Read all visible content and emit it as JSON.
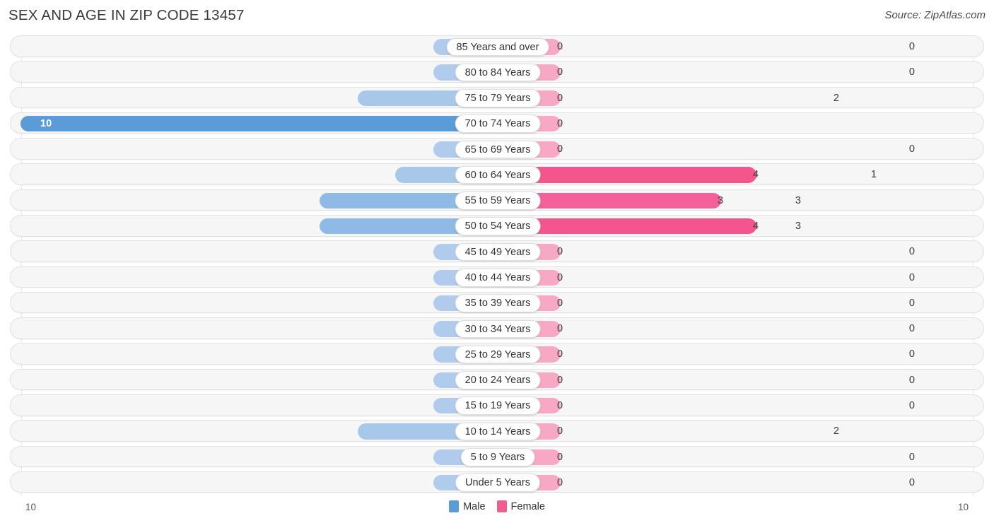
{
  "header": {
    "title": "SEX AND AGE IN ZIP CODE 13457",
    "source": "Source: ZipAtlas.com"
  },
  "legend": {
    "male_label": "Male",
    "female_label": "Female",
    "male_color": "#5b9bd8",
    "female_color": "#ef5e8f"
  },
  "axis": {
    "left_label": "10",
    "right_label": "10"
  },
  "colors": {
    "male_max": "#5b9bd8",
    "male_high": "#7fb0e0",
    "male_mid": "#8fbae6",
    "male_low": "#a8c8ea",
    "male_zero": "#b0cbec",
    "female_max": "#f4558c",
    "female_high": "#f4609a",
    "female_low": "#f78fb5",
    "female_zero": "#f7a8c4",
    "track": "#f6f6f6",
    "track_border": "#e2e2e2",
    "pill_bg": "#ffffff",
    "gridline": "#e8e8e8"
  },
  "chart_data": {
    "type": "bar",
    "subtype": "population-pyramid",
    "title": "SEX AND AGE IN ZIP CODE 13457",
    "xlabel": "",
    "ylabel": "",
    "xlim": [
      10,
      10
    ],
    "axis_max": 10,
    "grid": true,
    "legend_position": "bottom-center",
    "categories": [
      "85 Years and over",
      "80 to 84 Years",
      "75 to 79 Years",
      "70 to 74 Years",
      "65 to 69 Years",
      "60 to 64 Years",
      "55 to 59 Years",
      "50 to 54 Years",
      "45 to 49 Years",
      "40 to 44 Years",
      "35 to 39 Years",
      "30 to 34 Years",
      "25 to 29 Years",
      "20 to 24 Years",
      "15 to 19 Years",
      "10 to 14 Years",
      "5 to 9 Years",
      "Under 5 Years"
    ],
    "series": [
      {
        "name": "Male",
        "values": [
          0,
          0,
          2,
          10,
          0,
          1,
          3,
          3,
          0,
          0,
          0,
          0,
          0,
          0,
          0,
          2,
          0,
          0
        ]
      },
      {
        "name": "Female",
        "values": [
          0,
          0,
          0,
          0,
          0,
          4,
          3,
          4,
          0,
          0,
          0,
          0,
          0,
          0,
          0,
          0,
          0,
          0
        ]
      }
    ]
  },
  "rows": [
    {
      "age": "85 Years and over",
      "male": "0",
      "female": "0",
      "m_w": 75,
      "f_w": 75,
      "m_tone": "male_zero",
      "f_tone": "female_zero",
      "m_inside": false
    },
    {
      "age": "80 to 84 Years",
      "male": "0",
      "female": "0",
      "m_w": 75,
      "f_w": 75,
      "m_tone": "male_zero",
      "f_tone": "female_zero",
      "m_inside": false
    },
    {
      "age": "75 to 79 Years",
      "male": "2",
      "female": "0",
      "m_w": 182,
      "f_w": 75,
      "m_tone": "male_low",
      "f_tone": "female_zero",
      "m_inside": false
    },
    {
      "age": "70 to 74 Years",
      "male": "10",
      "female": "0",
      "m_w": 659,
      "f_w": 75,
      "m_tone": "male_max",
      "f_tone": "female_zero",
      "m_inside": true
    },
    {
      "age": "65 to 69 Years",
      "male": "0",
      "female": "0",
      "m_w": 75,
      "f_w": 75,
      "m_tone": "male_zero",
      "f_tone": "female_zero",
      "m_inside": false
    },
    {
      "age": "60 to 64 Years",
      "male": "1",
      "female": "4",
      "m_w": 129,
      "f_w": 352,
      "m_tone": "male_low",
      "f_tone": "female_max",
      "m_inside": false
    },
    {
      "age": "55 to 59 Years",
      "male": "3",
      "female": "3",
      "m_w": 236,
      "f_w": 302,
      "m_tone": "male_mid",
      "f_tone": "female_high",
      "m_inside": false
    },
    {
      "age": "50 to 54 Years",
      "male": "3",
      "female": "4",
      "m_w": 236,
      "f_w": 352,
      "m_tone": "male_mid",
      "f_tone": "female_max",
      "m_inside": false
    },
    {
      "age": "45 to 49 Years",
      "male": "0",
      "female": "0",
      "m_w": 75,
      "f_w": 75,
      "m_tone": "male_zero",
      "f_tone": "female_zero",
      "m_inside": false
    },
    {
      "age": "40 to 44 Years",
      "male": "0",
      "female": "0",
      "m_w": 75,
      "f_w": 75,
      "m_tone": "male_zero",
      "f_tone": "female_zero",
      "m_inside": false
    },
    {
      "age": "35 to 39 Years",
      "male": "0",
      "female": "0",
      "m_w": 75,
      "f_w": 75,
      "m_tone": "male_zero",
      "f_tone": "female_zero",
      "m_inside": false
    },
    {
      "age": "30 to 34 Years",
      "male": "0",
      "female": "0",
      "m_w": 75,
      "f_w": 75,
      "m_tone": "male_zero",
      "f_tone": "female_zero",
      "m_inside": false
    },
    {
      "age": "25 to 29 Years",
      "male": "0",
      "female": "0",
      "m_w": 75,
      "f_w": 75,
      "m_tone": "male_zero",
      "f_tone": "female_zero",
      "m_inside": false
    },
    {
      "age": "20 to 24 Years",
      "male": "0",
      "female": "0",
      "m_w": 75,
      "f_w": 75,
      "m_tone": "male_zero",
      "f_tone": "female_zero",
      "m_inside": false
    },
    {
      "age": "15 to 19 Years",
      "male": "0",
      "female": "0",
      "m_w": 75,
      "f_w": 75,
      "m_tone": "male_zero",
      "f_tone": "female_zero",
      "m_inside": false
    },
    {
      "age": "10 to 14 Years",
      "male": "2",
      "female": "0",
      "m_w": 182,
      "f_w": 75,
      "m_tone": "male_low",
      "f_tone": "female_zero",
      "m_inside": false
    },
    {
      "age": "5 to 9 Years",
      "male": "0",
      "female": "0",
      "m_w": 75,
      "f_w": 75,
      "m_tone": "male_zero",
      "f_tone": "female_zero",
      "m_inside": false
    },
    {
      "age": "Under 5 Years",
      "male": "0",
      "female": "0",
      "m_w": 75,
      "f_w": 75,
      "m_tone": "male_zero",
      "f_tone": "female_zero",
      "m_inside": false
    }
  ]
}
